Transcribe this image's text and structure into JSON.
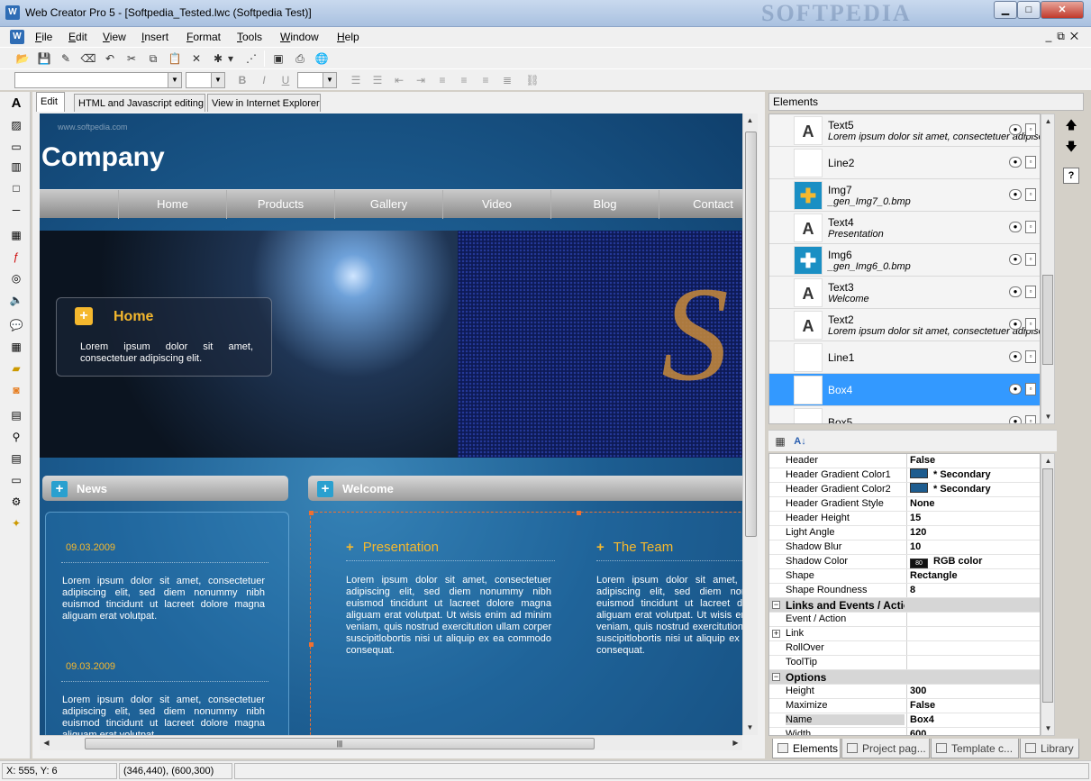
{
  "window": {
    "title": "Web Creator Pro 5 - [Softpedia_Tested.lwc (Softpedia Test)]",
    "watermark": "SOFTPEDIA",
    "app_icon": "wc-app-icon"
  },
  "menu": [
    "File",
    "Edit",
    "View",
    "Insert",
    "Format",
    "Tools",
    "Window",
    "Help"
  ],
  "editor": {
    "tabs": [
      "Edit",
      "HTML and Javascript editing",
      "View in Internet Explorer"
    ],
    "active_tab": "Edit"
  },
  "page": {
    "watermark": "www.softpedia.com",
    "company": "Company",
    "nav": [
      "Home",
      "Products",
      "Gallery",
      "Video",
      "Blog",
      "Contact"
    ],
    "home_box": {
      "heading": "Home",
      "text": "Lorem ipsum dolor sit amet, consectetuer adipiscing elit."
    },
    "news_header": "News",
    "welcome_header": "Welcome",
    "news": [
      {
        "date": "09.03.2009",
        "text": "Lorem ipsum dolor sit amet, consectetuer adipiscing elit, sed diem nonummy nibh euismod tincidunt ut lacreet dolore magna aliguam erat volutpat."
      },
      {
        "date": "09.03.2009",
        "text": "Lorem ipsum dolor sit amet, consectetuer adipiscing elit, sed diem nonummy nibh euismod tincidunt ut lacreet dolore magna aliguam erat volutpat."
      }
    ],
    "columns": [
      {
        "heading": "Presentation",
        "text": "Lorem ipsum dolor sit amet, consectetuer adipiscing elit, sed diem nonummy nibh euismod tincidunt ut lacreet dolore magna aliguam erat volutpat. Ut wisis enim ad minim veniam, quis nostrud exercitution ullam corper suscipitlobortis nisi ut aliquip ex ea commodo consequat."
      },
      {
        "heading": "The Team",
        "text": "Lorem ipsum dolor sit amet, consectetuer adipiscing elit, sed diem nonummy nibh euismod tincidunt ut lacreet dolore magna aliguam erat volutpat. Ut wisis enim ad minim veniam, quis nostrud exercitution ullam corper suscipitlobortis nisi ut aliquip ex ea commodo consequat."
      }
    ],
    "colors": {
      "accent": "#f5b82e",
      "background": "#1d5e92"
    }
  },
  "elements_panel": {
    "title": "Elements",
    "items": [
      {
        "name": "Text5",
        "sub": "Lorem ipsum dolor sit amet, consectetuer adipiscing",
        "icon": "A"
      },
      {
        "name": "Line2",
        "sub": "",
        "icon": ""
      },
      {
        "name": "Img7",
        "sub": "_gen_Img7_0.bmp",
        "icon": "✚"
      },
      {
        "name": "Text4",
        "sub": "Presentation",
        "icon": "A"
      },
      {
        "name": "Img6",
        "sub": "_gen_Img6_0.bmp",
        "icon": "✚"
      },
      {
        "name": "Text3",
        "sub": "Welcome",
        "icon": "A"
      },
      {
        "name": "Text2",
        "sub": "Lorem ipsum dolor sit amet, consectetuer adipiscing",
        "icon": "A"
      },
      {
        "name": "Line1",
        "sub": "",
        "icon": ""
      },
      {
        "name": "Box4",
        "sub": "",
        "icon": "",
        "selected": true
      },
      {
        "name": "Box5",
        "sub": "",
        "icon": ""
      }
    ]
  },
  "properties": [
    {
      "name": "Header",
      "value": "False"
    },
    {
      "name": "Header Gradient Color1",
      "value": "* Secondary",
      "swatch": "blue"
    },
    {
      "name": "Header Gradient Color2",
      "value": "* Secondary",
      "swatch": "blue"
    },
    {
      "name": "Header Gradient Style",
      "value": "None"
    },
    {
      "name": "Header Height",
      "value": "15"
    },
    {
      "name": "Light Angle",
      "value": "120"
    },
    {
      "name": "Shadow Blur",
      "value": "10"
    },
    {
      "name": "Shadow Color",
      "value": "RGB color",
      "swatch": "black",
      "swatch_text": "80"
    },
    {
      "name": "Shape",
      "value": "Rectangle"
    },
    {
      "name": "Shape Roundness",
      "value": "8"
    },
    {
      "name": "Links and Events / Actions",
      "category": true
    },
    {
      "name": "Event / Action",
      "value": ""
    },
    {
      "name": "Link",
      "value": "",
      "expandable": true
    },
    {
      "name": "RollOver",
      "value": ""
    },
    {
      "name": "ToolTip",
      "value": ""
    },
    {
      "name": "Options",
      "category": true
    },
    {
      "name": "Height",
      "value": "300"
    },
    {
      "name": "Maximize",
      "value": "False"
    },
    {
      "name": "Name",
      "value": "Box4",
      "selected": true
    },
    {
      "name": "Width",
      "value": "600"
    }
  ],
  "bottom_tabs": [
    "Elements",
    "Project pag...",
    "Template c...",
    "Library"
  ],
  "status": {
    "cursor": "X: 555, Y: 6",
    "selection": "(346,440), (600,300)"
  }
}
